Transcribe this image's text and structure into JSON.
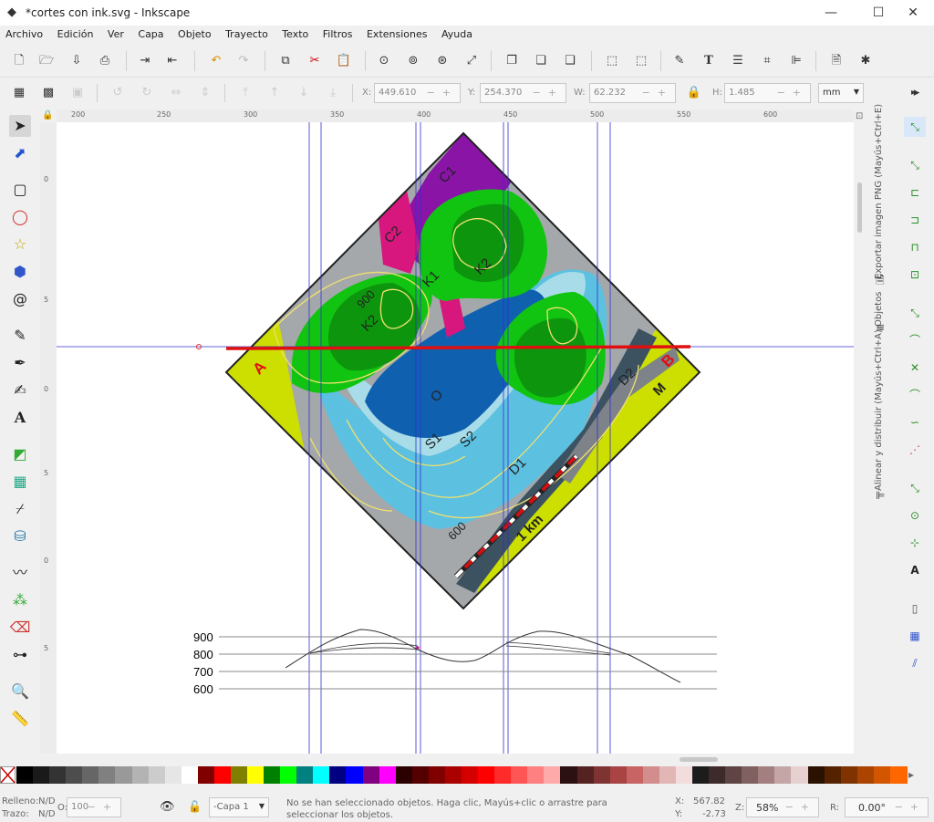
{
  "window": {
    "title": "*cortes con ink.svg - Inkscape",
    "minimize": "—",
    "maximize": "☐",
    "close": "✕"
  },
  "menu": [
    "Archivo",
    "Edición",
    "Ver",
    "Capa",
    "Objeto",
    "Trayecto",
    "Texto",
    "Filtros",
    "Extensiones",
    "Ayuda"
  ],
  "toolcontrols": {
    "x_label": "X:",
    "x_value": "449.610",
    "y_label": "Y:",
    "y_value": "254.370",
    "w_label": "W:",
    "w_value": "62.232",
    "h_label": "H:",
    "h_value": "1.485",
    "units": "mm"
  },
  "ruler": {
    "top_ticks": [
      "200",
      "250",
      "300",
      "350",
      "400",
      "450",
      "500",
      "550",
      "600"
    ],
    "left_ticks": [
      "0",
      "5",
      "0",
      "5",
      "0",
      "5"
    ]
  },
  "dock_tabs": {
    "export": "Exportar imagen PNG (Mayús+Ctrl+E)",
    "objects": "Objetos",
    "align": "Alinear y distribuir (Mayús+Ctrl+A)"
  },
  "map": {
    "labels": {
      "c1": "C1",
      "c2": "C2",
      "k1": "K1",
      "k2a": "K2",
      "k2b": "K2",
      "o": "O",
      "s1": "S1",
      "s2": "S2",
      "d1": "D1",
      "d2": "D2",
      "m": "M",
      "a": "A",
      "b": "B",
      "c900": "900",
      "c600": "600",
      "scale": "1 km"
    },
    "colors": {
      "frame": "#222222",
      "c1": "#8a14a6",
      "c2": "#d8177e",
      "k1": "#11c411",
      "k2": "#0d960d",
      "o": "#1060b0",
      "s1": "#a8dce8",
      "s2": "#5cc0e0",
      "d1": "#a4a8ab",
      "d2": "#7d8388",
      "m": "#cddf00",
      "edge": "#3c5260",
      "section": "#e01010",
      "guide": "#3030d0"
    }
  },
  "profile": {
    "levels": [
      "900",
      "800",
      "700",
      "600"
    ]
  },
  "status": {
    "fill_label": "Relleno:",
    "fill_value": "N/D",
    "stroke_label": "Trazo:",
    "stroke_value": "N/D",
    "opacity_label": "O:",
    "opacity_value": "100",
    "layer": "-Capa 1",
    "message": "No se han seleccionado objetos. Haga clic, Mayús+clic o arrastre para seleccionar los objetos.",
    "x_label": "X:",
    "x_value": "567.82",
    "y_label": "Y:",
    "y_value": "-2.73",
    "zoom_label": "Z:",
    "zoom_value": "58%",
    "rotate_label": "R:",
    "rotate_value": "0.00°"
  },
  "palette_colors": [
    "#000000",
    "#1a1a1a",
    "#333333",
    "#4d4d4d",
    "#666666",
    "#808080",
    "#999999",
    "#b3b3b3",
    "#cccccc",
    "#e6e6e6",
    "#ffffff",
    "#800000",
    "#ff0000",
    "#808000",
    "#ffff00",
    "#008000",
    "#00ff00",
    "#008080",
    "#00ffff",
    "#000080",
    "#0000ff",
    "#800080",
    "#ff00ff",
    "#2b0000",
    "#550000",
    "#800000",
    "#aa0000",
    "#d40000",
    "#ff0000",
    "#ff2a2a",
    "#ff5555",
    "#ff8080",
    "#ffaaaa",
    "#2b1111",
    "#552222",
    "#803333",
    "#aa4444",
    "#c86464",
    "#d38d8d",
    "#e3b6b6",
    "#f2dcdc",
    "#1c1c1c",
    "#3d2b2b",
    "#5e4444",
    "#806060",
    "#a37f7f",
    "#c4a6a6",
    "#e6d0d0",
    "#2b1100",
    "#552200",
    "#803300",
    "#aa4400",
    "#d45500",
    "#ff6600"
  ]
}
